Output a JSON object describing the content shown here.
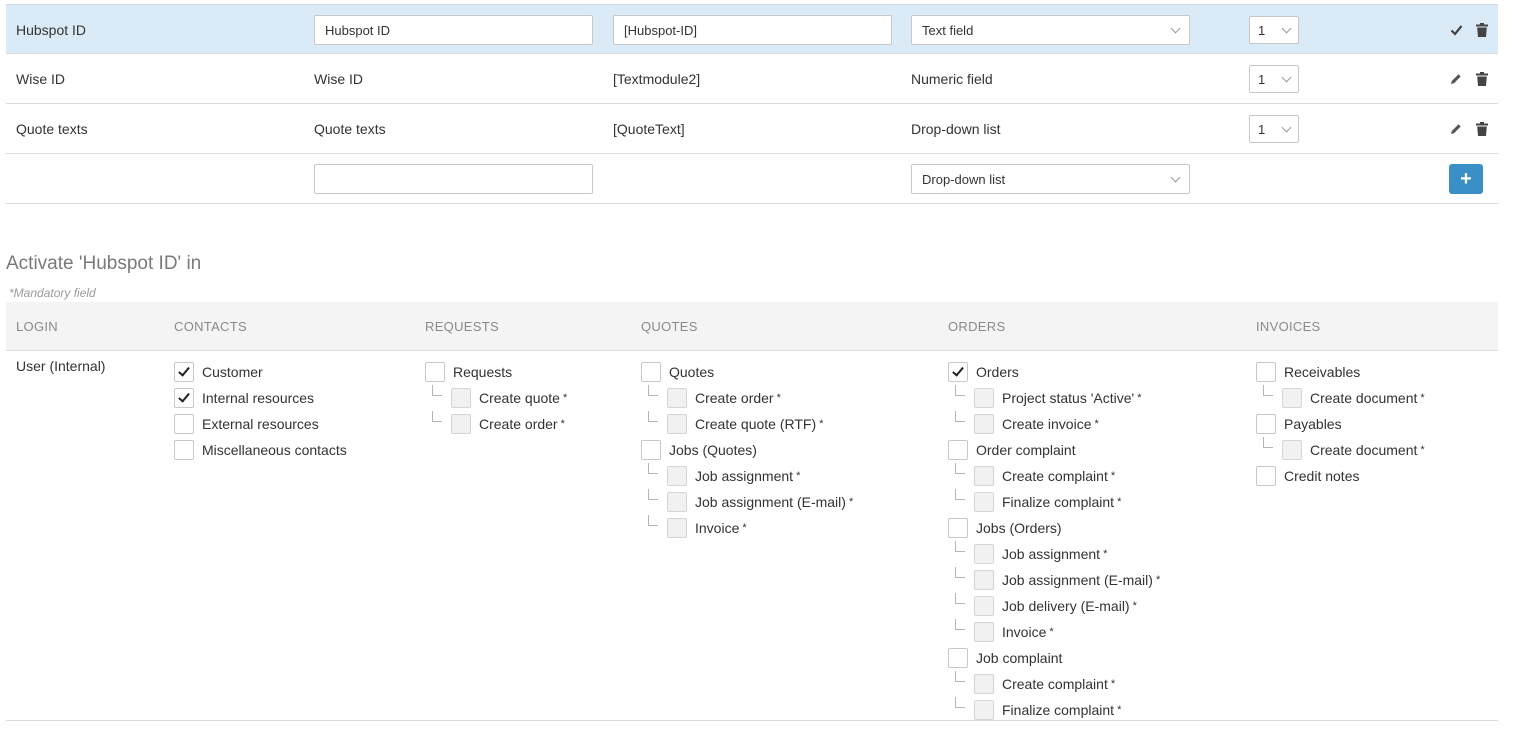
{
  "fields": {
    "rows": [
      {
        "name": "Hubspot ID",
        "label": "Hubspot ID",
        "placeholder": "[Hubspot-ID]",
        "type": "Text field",
        "order": "1"
      },
      {
        "name": "Wise ID",
        "label": "Wise ID",
        "placeholder": "[Textmodule2]",
        "type": "Numeric field",
        "order": "1"
      },
      {
        "name": "Quote texts",
        "label": "Quote texts",
        "placeholder": "[QuoteText]",
        "type": "Drop-down list",
        "order": "1"
      }
    ],
    "new_row": {
      "label_value": "",
      "type": "Drop-down list",
      "add_label": "+"
    }
  },
  "activation": {
    "title": "Activate 'Hubspot ID' in",
    "mandatory_note": "*Mandatory field",
    "columns": {
      "login": "LOGIN",
      "contacts": "CONTACTS",
      "requests": "REQUESTS",
      "quotes": "QUOTES",
      "orders": "ORDERS",
      "invoices": "INVOICES"
    },
    "login_value": "User (Internal)",
    "contacts": [
      {
        "label": "Customer",
        "checked": true,
        "sub": false,
        "star": ""
      },
      {
        "label": "Internal resources",
        "checked": true,
        "sub": false,
        "star": ""
      },
      {
        "label": "External resources",
        "checked": false,
        "sub": false,
        "star": ""
      },
      {
        "label": "Miscellaneous contacts",
        "checked": false,
        "sub": false,
        "star": ""
      }
    ],
    "requests": [
      {
        "label": "Requests",
        "checked": false,
        "sub": false,
        "star": ""
      },
      {
        "label": "Create quote",
        "checked": false,
        "sub": true,
        "star": "*"
      },
      {
        "label": "Create order",
        "checked": false,
        "sub": true,
        "star": "*"
      }
    ],
    "quotes": [
      {
        "label": "Quotes",
        "checked": false,
        "sub": false,
        "star": ""
      },
      {
        "label": "Create order",
        "checked": false,
        "sub": true,
        "star": "*"
      },
      {
        "label": "Create quote (RTF)",
        "checked": false,
        "sub": true,
        "star": "*"
      },
      {
        "label": "Jobs (Quotes)",
        "checked": false,
        "sub": false,
        "star": ""
      },
      {
        "label": "Job assignment",
        "checked": false,
        "sub": true,
        "star": "*"
      },
      {
        "label": "Job assignment (E-mail)",
        "checked": false,
        "sub": true,
        "star": "*"
      },
      {
        "label": "Invoice",
        "checked": false,
        "sub": true,
        "star": "*"
      }
    ],
    "orders": [
      {
        "label": "Orders",
        "checked": true,
        "sub": false,
        "star": ""
      },
      {
        "label": "Project status 'Active'",
        "checked": false,
        "sub": true,
        "star": "*"
      },
      {
        "label": "Create invoice",
        "checked": false,
        "sub": true,
        "star": "*"
      },
      {
        "label": "Order complaint",
        "checked": false,
        "sub": false,
        "star": ""
      },
      {
        "label": "Create complaint",
        "checked": false,
        "sub": true,
        "star": "*"
      },
      {
        "label": "Finalize complaint",
        "checked": false,
        "sub": true,
        "star": "*"
      },
      {
        "label": "Jobs (Orders)",
        "checked": false,
        "sub": false,
        "star": ""
      },
      {
        "label": "Job assignment",
        "checked": false,
        "sub": true,
        "star": "*"
      },
      {
        "label": "Job assignment (E-mail)",
        "checked": false,
        "sub": true,
        "star": "*"
      },
      {
        "label": "Job delivery (E-mail)",
        "checked": false,
        "sub": true,
        "star": "*"
      },
      {
        "label": "Invoice",
        "checked": false,
        "sub": true,
        "star": "*"
      },
      {
        "label": "Job complaint",
        "checked": false,
        "sub": false,
        "star": ""
      },
      {
        "label": "Create complaint",
        "checked": false,
        "sub": true,
        "star": "*"
      },
      {
        "label": "Finalize complaint",
        "checked": false,
        "sub": true,
        "star": "*"
      }
    ],
    "invoices": [
      {
        "label": "Receivables",
        "checked": false,
        "sub": false,
        "star": ""
      },
      {
        "label": "Create document",
        "checked": false,
        "sub": true,
        "star": "*"
      },
      {
        "label": "Payables",
        "checked": false,
        "sub": false,
        "star": ""
      },
      {
        "label": "Create document",
        "checked": false,
        "sub": true,
        "star": "*"
      },
      {
        "label": "Credit notes",
        "checked": false,
        "sub": false,
        "star": ""
      }
    ]
  },
  "colors": {
    "selected_row": "#dbeaf7",
    "accent": "#3a8fc7",
    "header_bg": "#f4f4f4"
  }
}
